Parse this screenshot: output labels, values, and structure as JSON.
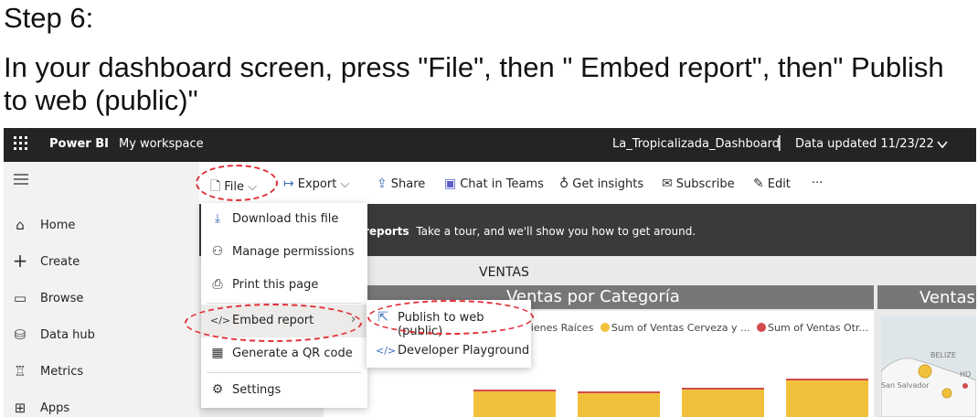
{
  "heading": {
    "step": "Step 6:",
    "instruction": "In your dashboard screen, press \"File\", then \" Embed report\", then\" Publish to web (public)\""
  },
  "topbar": {
    "brand": "Power BI",
    "workspace": "My workspace",
    "dashboard": "La_Tropicalizada_Dashboard",
    "separator": "|",
    "data_updated": "Data updated 11/23/22"
  },
  "nav": {
    "items": [
      {
        "label": "Home",
        "icon": "home-icon"
      },
      {
        "label": "Create",
        "icon": "plus-icon"
      },
      {
        "label": "Browse",
        "icon": "folder-icon"
      },
      {
        "label": "Data hub",
        "icon": "database-icon"
      },
      {
        "label": "Metrics",
        "icon": "trophy-icon"
      },
      {
        "label": "Apps",
        "icon": "apps-icon"
      }
    ]
  },
  "toolbar": {
    "file": "File",
    "export": "Export",
    "share": "Share",
    "chat": "Chat in Teams",
    "insights": "Get insights",
    "subscribe": "Subscribe",
    "edit": "Edit",
    "more": "···"
  },
  "banner": {
    "bold": "reports",
    "text": "Take a tour, and we'll show you how to get around."
  },
  "file_menu": {
    "items": [
      {
        "label": "Download this file",
        "icon": "download-icon"
      },
      {
        "label": "Manage permissions",
        "icon": "permissions-icon"
      },
      {
        "label": "Print this page",
        "icon": "printer-icon"
      },
      {
        "label": "Embed report",
        "icon": "code-icon"
      },
      {
        "label": "Generate a QR code",
        "icon": "qr-code-icon"
      },
      {
        "label": "Settings",
        "icon": "gear-icon"
      }
    ]
  },
  "submenu": {
    "items": [
      {
        "label": "Publish to web (public)",
        "icon": "publish-icon"
      },
      {
        "label": "Developer Playground",
        "icon": "code-icon"
      }
    ]
  },
  "report": {
    "page_title": "VENTAS",
    "chart_title": "Ventas por Categoría",
    "map_title": "Ventas",
    "legend": [
      {
        "label": "s Bienes Raíces",
        "color": ""
      },
      {
        "label": "Sum of Ventas Cerveza y ...",
        "color": "#f2c13b"
      },
      {
        "label": "Sum of Ventas Otr...",
        "color": "#d14c4c"
      }
    ],
    "map_labels": [
      "BELIZE",
      "San Salvador",
      "HO"
    ]
  },
  "colors": {
    "topbar": "#252423",
    "accent": "#3b6fb6",
    "bar": "#f2c13b",
    "highlight": "#e0303a"
  }
}
